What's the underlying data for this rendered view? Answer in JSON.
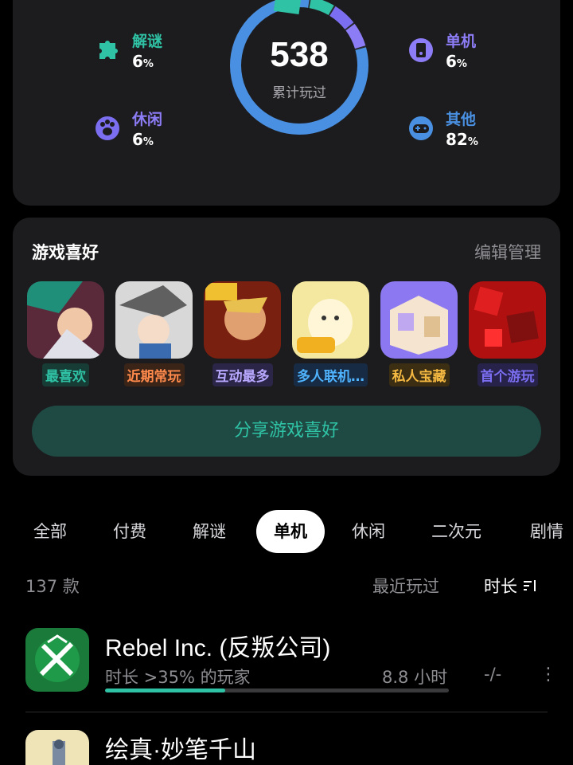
{
  "stats": {
    "total": "538",
    "total_label": "累计玩过",
    "categories": [
      {
        "label": "解谜",
        "pct": "6",
        "color": "#2fc2a5",
        "icon": "puzzle-icon"
      },
      {
        "label": "休闲",
        "pct": "6",
        "color": "#7b6ef0",
        "icon": "paw-icon"
      },
      {
        "label": "单机",
        "pct": "6",
        "color": "#8c7cf5",
        "icon": "device-icon"
      },
      {
        "label": "其他",
        "pct": "82",
        "color": "#4a90e2",
        "icon": "gamepad-icon"
      }
    ],
    "percent_sign": "%"
  },
  "prefs": {
    "title": "游戏喜好",
    "manage": "编辑管理",
    "games": [
      {
        "tag": "最喜欢",
        "tag_color": "#2fc2a5",
        "tag_bg": "#173c36"
      },
      {
        "tag": "近期常玩",
        "tag_color": "#ff8a4c",
        "tag_bg": "#3a2418"
      },
      {
        "tag": "互动最多",
        "tag_color": "#b8a8ff",
        "tag_bg": "#2b2547"
      },
      {
        "tag": "多人联机…",
        "tag_color": "#4fb3ff",
        "tag_bg": "#172c44"
      },
      {
        "tag": "私人宝藏",
        "tag_color": "#f5b942",
        "tag_bg": "#3b2e13"
      },
      {
        "tag": "首个游玩",
        "tag_color": "#7b6ef0",
        "tag_bg": "#26224a"
      }
    ],
    "share": "分享游戏喜好"
  },
  "tabs": [
    "全部",
    "付费",
    "解谜",
    "单机",
    "休闲",
    "二次元",
    "剧情"
  ],
  "active_tab": "单机",
  "list": {
    "count": "137 款",
    "sort_recent": "最近玩过",
    "sort_duration": "时长",
    "items": [
      {
        "title": "Rebel Inc. (反叛公司)",
        "subtitle": "时长 >35% 的玩家",
        "hours": "8.8 小时",
        "extra": "-/-",
        "progress": 0.35
      },
      {
        "title": "绘真·妙笔千山"
      }
    ]
  }
}
